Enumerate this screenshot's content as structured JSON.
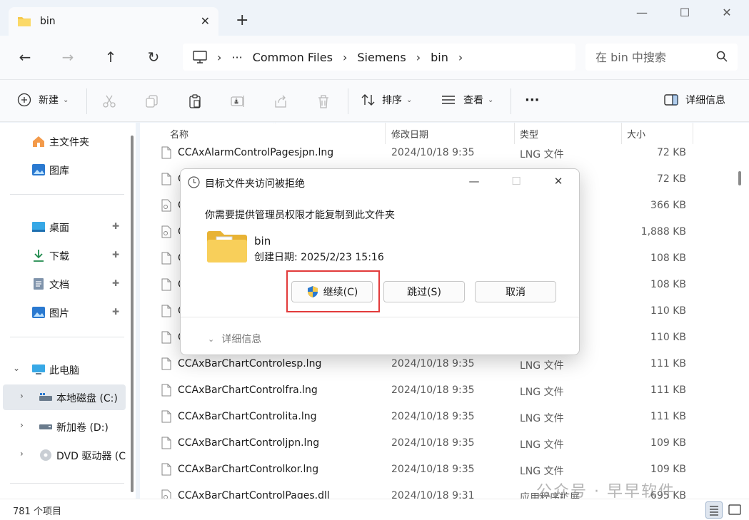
{
  "window": {
    "tab_title": "bin",
    "close_tab": "✕",
    "new_tab": "+",
    "minimize": "—",
    "maximize": "☐",
    "close": "✕"
  },
  "nav": {
    "back": "←",
    "forward": "→",
    "up": "↑",
    "refresh": "↻",
    "breadcrumb": [
      "Common Files",
      "Siemens",
      "bin"
    ],
    "ellipsis": "···",
    "search_placeholder": "在 bin 中搜索"
  },
  "commands": {
    "new": "新建",
    "sort": "排序",
    "view": "查看",
    "more": "···",
    "details": "详细信息"
  },
  "sidebar": {
    "items": [
      {
        "label": "主文件夹",
        "icon": "home-icon"
      },
      {
        "label": "图库",
        "icon": "gallery-icon"
      },
      {
        "label": "桌面",
        "icon": "desktop-icon",
        "pinned": true
      },
      {
        "label": "下载",
        "icon": "download-icon",
        "pinned": true
      },
      {
        "label": "文档",
        "icon": "document-icon",
        "pinned": true
      },
      {
        "label": "图片",
        "icon": "picture-icon",
        "pinned": true
      },
      {
        "label": "此电脑",
        "icon": "computer-icon"
      },
      {
        "label": "本地磁盘 (C:)",
        "icon": "drive-icon"
      },
      {
        "label": "新加卷 (D:)",
        "icon": "drive-icon"
      },
      {
        "label": "DVD 驱动器 (C",
        "icon": "dvd-icon"
      }
    ],
    "pin_glyph": "📌",
    "expand_right": "›",
    "expand_down": "⌄"
  },
  "columns": {
    "name": "名称",
    "date": "修改日期",
    "type": "类型",
    "size": "大小",
    "sort_arrow": "⌃"
  },
  "files": [
    {
      "name": "CCAxAlarmControlPagesjpn.lng",
      "date": "2024/10/18 9:35",
      "type": "LNG 文件",
      "size": "72 KB",
      "kind": "file"
    },
    {
      "name": "C",
      "date": "",
      "type": "",
      "size": "72 KB",
      "kind": "file"
    },
    {
      "name": "C",
      "date": "",
      "type": "",
      "size": "366 KB",
      "kind": "dll"
    },
    {
      "name": "C",
      "date": "",
      "type": "",
      "size": "1,888 KB",
      "kind": "dll"
    },
    {
      "name": "C",
      "date": "",
      "type": "",
      "size": "108 KB",
      "kind": "file"
    },
    {
      "name": "C",
      "date": "",
      "type": "",
      "size": "108 KB",
      "kind": "file"
    },
    {
      "name": "C",
      "date": "",
      "type": "",
      "size": "110 KB",
      "kind": "file"
    },
    {
      "name": "C",
      "date": "",
      "type": "",
      "size": "110 KB",
      "kind": "file"
    },
    {
      "name": "CCAxBarChartControlesp.lng",
      "date": "2024/10/18 9:35",
      "type": "LNG 文件",
      "size": "111 KB",
      "kind": "file"
    },
    {
      "name": "CCAxBarChartControlfra.lng",
      "date": "2024/10/18 9:35",
      "type": "LNG 文件",
      "size": "111 KB",
      "kind": "file"
    },
    {
      "name": "CCAxBarChartControlita.lng",
      "date": "2024/10/18 9:35",
      "type": "LNG 文件",
      "size": "111 KB",
      "kind": "file"
    },
    {
      "name": "CCAxBarChartControljpn.lng",
      "date": "2024/10/18 9:35",
      "type": "LNG 文件",
      "size": "109 KB",
      "kind": "file"
    },
    {
      "name": "CCAxBarChartControlkor.lng",
      "date": "2024/10/18 9:35",
      "type": "LNG 文件",
      "size": "109 KB",
      "kind": "file"
    },
    {
      "name": "CCAxBarChartControlPages.dll",
      "date": "2024/10/18 9:31",
      "type": "应用程序扩展",
      "size": "695 KB",
      "kind": "dll"
    }
  ],
  "status": {
    "count": "781 个项目"
  },
  "watermark": "公众号 · 早早软件",
  "dialog": {
    "title": "目标文件夹访问被拒绝",
    "message": "你需要提供管理员权限才能复制到此文件夹",
    "folder_name": "bin",
    "created": "创建日期: 2025/2/23 15:16",
    "continue": "继续(C)",
    "skip": "跳过(S)",
    "cancel": "取消",
    "more_details": "详细信息",
    "minimize": "—",
    "maximize": "☐",
    "close": "✕"
  },
  "colors": {
    "accent": "#0067c0",
    "folder": "#f6c94c",
    "highlight": "#e23b3b"
  }
}
